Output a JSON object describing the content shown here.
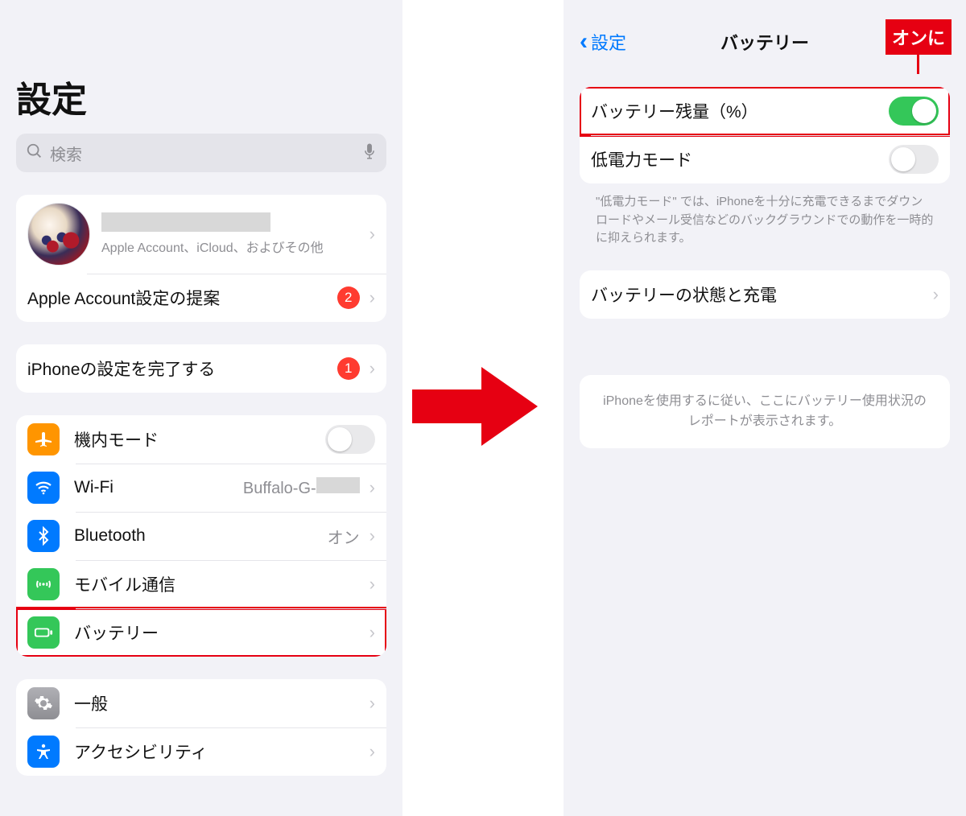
{
  "callout": "オンに",
  "arrow_color": "#e60012",
  "left": {
    "title": "設定",
    "search_placeholder": "検索",
    "account": {
      "subtitle": "Apple Account、iCloud、およびその他"
    },
    "account_suggestion": {
      "label": "Apple Account設定の提案",
      "badge": "2"
    },
    "setup": {
      "label": "iPhoneの設定を完了する",
      "badge": "1"
    },
    "list": {
      "airplane": "機内モード",
      "wifi": "Wi-Fi",
      "wifi_value_prefix": "Buffalo-G-",
      "bluetooth": "Bluetooth",
      "bluetooth_value": "オン",
      "cellular": "モバイル通信",
      "battery": "バッテリー"
    },
    "list2": {
      "general": "一般",
      "accessibility": "アクセシビリティ"
    }
  },
  "right": {
    "back": "設定",
    "title": "バッテリー",
    "rows": {
      "percent": "バッテリー残量（%）",
      "lowpower": "低電力モード"
    },
    "lowpower_note": "\"低電力モード\" では、iPhoneを十分に充電できるまでダウンロードやメール受信などのバックグラウンドでの動作を一時的に抑えられます。",
    "health": "バッテリーの状態と充電",
    "usage_note": "iPhoneを使用するに従い、ここにバッテリー使用状況のレポートが表示されます。"
  }
}
